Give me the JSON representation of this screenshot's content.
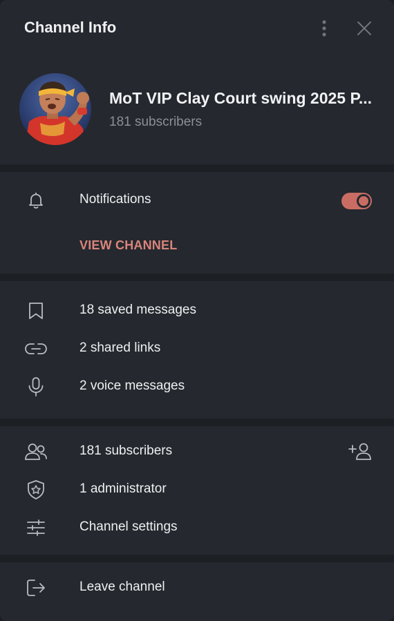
{
  "header": {
    "title": "Channel Info"
  },
  "channel": {
    "name": "MoT VIP Clay Court swing 2025 P...",
    "subscribers": "181 subscribers"
  },
  "notifications": {
    "label": "Notifications",
    "enabled": true
  },
  "view_channel": "VIEW CHANNEL",
  "media": {
    "saved": "18 saved messages",
    "links": "2 shared links",
    "voice": "2 voice messages"
  },
  "members": {
    "subscribers": "181 subscribers",
    "admins": "1 administrator",
    "settings": "Channel settings"
  },
  "leave": "Leave channel",
  "colors": {
    "accent": "#c96d64",
    "accent_text": "#d8857b",
    "panel": "#25282e"
  }
}
